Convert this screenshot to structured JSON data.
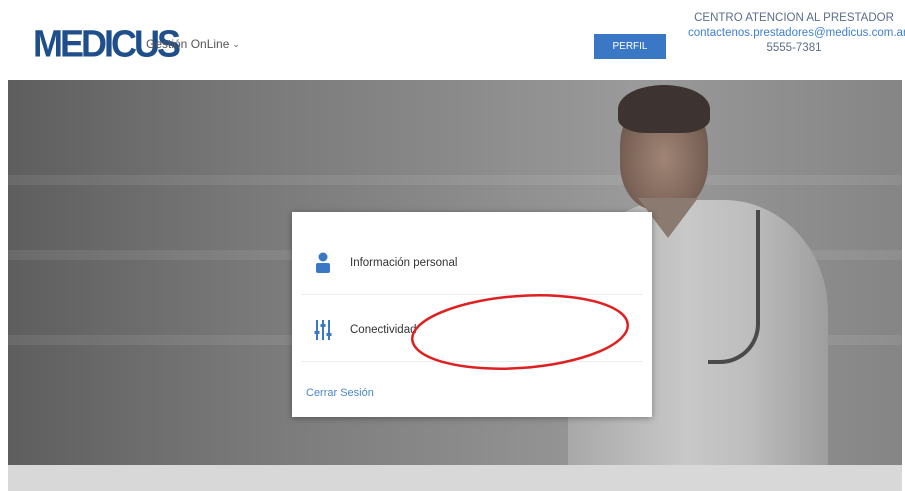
{
  "header": {
    "logo_text": "MEDICUS",
    "app_menu_label": "Gestión OnLine",
    "perfil_label": "PERFIL",
    "contact_title": "CENTRO ATENCION AL PRESTADOR",
    "contact_email": "contactenos.prestadores@medicus.com.ar",
    "contact_phone": "5555-7381"
  },
  "menu": {
    "items": [
      {
        "label": "Información personal",
        "icon": "user-icon"
      },
      {
        "label": "Conectividad",
        "icon": "sliders-icon"
      }
    ],
    "logout_label": "Cerrar Sesión"
  },
  "colors": {
    "brand": "#1f4e8c",
    "button": "#3a78c6",
    "link": "#4a86c8",
    "annotation": "#e02020"
  }
}
